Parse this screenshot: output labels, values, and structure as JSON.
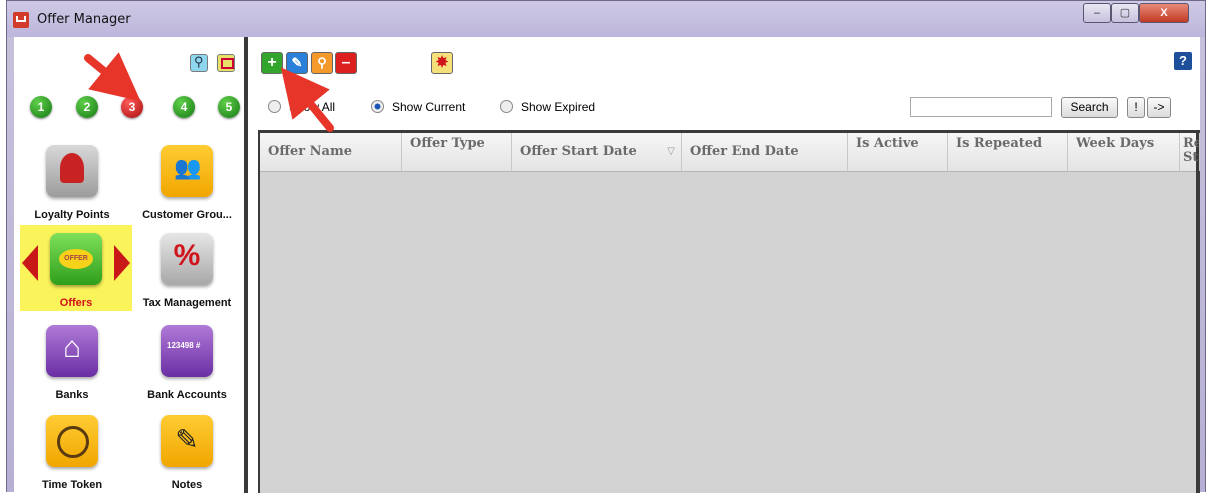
{
  "window": {
    "title": "Offer Manager",
    "controls": {
      "minimize": "–",
      "maximize": "▢",
      "close": "X"
    }
  },
  "left_panel": {
    "page_numbers": [
      "1",
      "2",
      "3",
      "4",
      "5"
    ],
    "active_page": "3",
    "tiles": [
      {
        "label": "Loyalty Points",
        "icon": "loyalty-ribbon-icon"
      },
      {
        "label": "Customer Grou...",
        "icon": "customer-group-icon"
      },
      {
        "label": "Offers",
        "icon": "offer-tag-icon",
        "selected": true
      },
      {
        "label": "Tax Management",
        "icon": "percent-icon"
      },
      {
        "label": "Banks",
        "icon": "bank-building-icon"
      },
      {
        "label": "Bank Accounts",
        "icon": "bank-card-icon"
      },
      {
        "label": "Time Token",
        "icon": "clock-icon"
      },
      {
        "label": "Notes",
        "icon": "notepad-icon"
      }
    ]
  },
  "toolbar": {
    "add": "+",
    "edit": "✎",
    "find": "⚲",
    "delete": "–",
    "special": "✸",
    "help": "?"
  },
  "filters": {
    "show_all": "Show All",
    "show_current": "Show Current",
    "show_expired": "Show Expired",
    "selected": "Show Current"
  },
  "search": {
    "value": "",
    "button": "Search",
    "bang": "!",
    "go": "->"
  },
  "grid": {
    "columns": [
      {
        "label": "Offer Name"
      },
      {
        "label": "Offer Type"
      },
      {
        "label": "Offer Start Date"
      },
      {
        "label": "Offer End Date"
      },
      {
        "label": "Is Active"
      },
      {
        "label": "Is Repeated"
      },
      {
        "label": "Week Days"
      },
      {
        "label": "Re St"
      }
    ],
    "rows": []
  },
  "colors": {
    "title_bar": "#c4bedc",
    "selected_tile": "#fbf35a",
    "grid_body": "#d3d3d3",
    "annotation_arrow": "#e8352a"
  }
}
